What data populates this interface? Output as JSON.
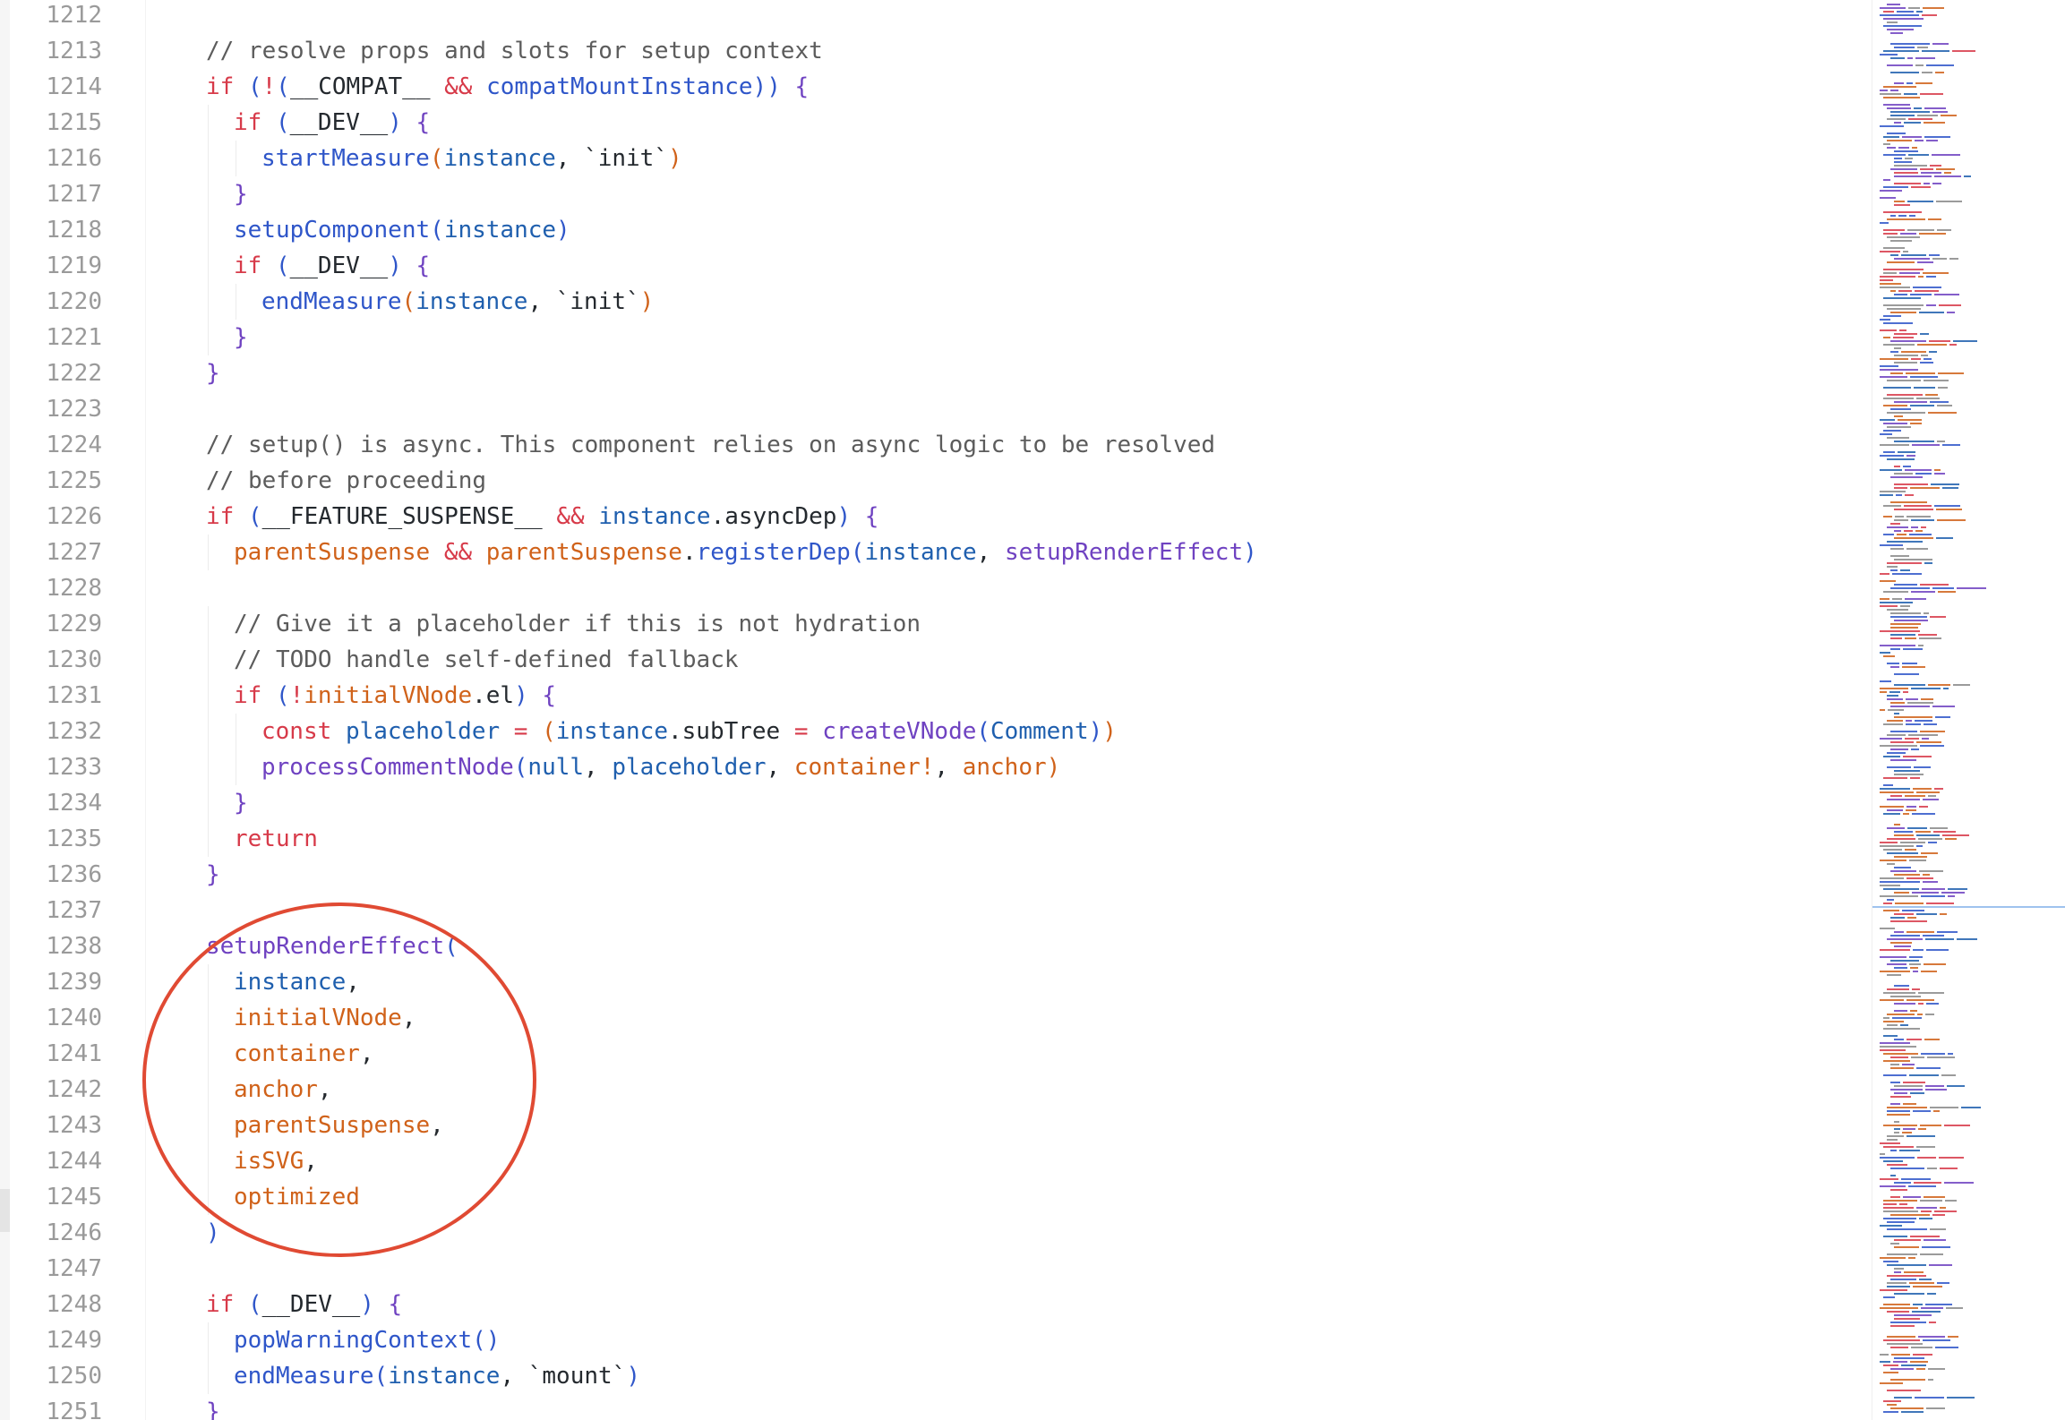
{
  "editor": {
    "language": "TypeScript",
    "first_line": 1212,
    "lines": [
      {
        "n": "1212",
        "indent": 0,
        "tokens": []
      },
      {
        "n": "1213",
        "indent": 1,
        "tokens": [
          {
            "t": "// resolve props and slots for setup context",
            "c": "cm"
          }
        ]
      },
      {
        "n": "1214",
        "indent": 1,
        "tokens": [
          {
            "t": "if",
            "c": "kw"
          },
          {
            "t": " ",
            "c": "pun"
          },
          {
            "t": "(",
            "c": "par"
          },
          {
            "t": "!",
            "c": "op"
          },
          {
            "t": "(",
            "c": "par"
          },
          {
            "t": "__COMPAT__",
            "c": "str"
          },
          {
            "t": " ",
            "c": "pun"
          },
          {
            "t": "&&",
            "c": "op"
          },
          {
            "t": " ",
            "c": "pun"
          },
          {
            "t": "compatMountInstance",
            "c": "fn"
          },
          {
            "t": ")",
            "c": "par"
          },
          {
            "t": ")",
            "c": "par"
          },
          {
            "t": " ",
            "c": "pun"
          },
          {
            "t": "{",
            "c": "fnp"
          }
        ]
      },
      {
        "n": "1215",
        "indent": 2,
        "tokens": [
          {
            "t": "if",
            "c": "kw"
          },
          {
            "t": " ",
            "c": "pun"
          },
          {
            "t": "(",
            "c": "par"
          },
          {
            "t": "__DEV__",
            "c": "str"
          },
          {
            "t": ")",
            "c": "par"
          },
          {
            "t": " ",
            "c": "pun"
          },
          {
            "t": "{",
            "c": "fnp"
          }
        ]
      },
      {
        "n": "1216",
        "indent": 3,
        "tokens": [
          {
            "t": "startMeasure",
            "c": "fn"
          },
          {
            "t": "(",
            "c": "param"
          },
          {
            "t": "instance",
            "c": "var"
          },
          {
            "t": ", ",
            "c": "pun"
          },
          {
            "t": "`init`",
            "c": "str"
          },
          {
            "t": ")",
            "c": "param"
          }
        ]
      },
      {
        "n": "1217",
        "indent": 2,
        "tokens": [
          {
            "t": "}",
            "c": "fnp"
          }
        ]
      },
      {
        "n": "1218",
        "indent": 2,
        "tokens": [
          {
            "t": "setupComponent",
            "c": "fn"
          },
          {
            "t": "(",
            "c": "par"
          },
          {
            "t": "instance",
            "c": "var"
          },
          {
            "t": ")",
            "c": "par"
          }
        ]
      },
      {
        "n": "1219",
        "indent": 2,
        "tokens": [
          {
            "t": "if",
            "c": "kw"
          },
          {
            "t": " ",
            "c": "pun"
          },
          {
            "t": "(",
            "c": "par"
          },
          {
            "t": "__DEV__",
            "c": "str"
          },
          {
            "t": ")",
            "c": "par"
          },
          {
            "t": " ",
            "c": "pun"
          },
          {
            "t": "{",
            "c": "fnp"
          }
        ]
      },
      {
        "n": "1220",
        "indent": 3,
        "tokens": [
          {
            "t": "endMeasure",
            "c": "fn"
          },
          {
            "t": "(",
            "c": "param"
          },
          {
            "t": "instance",
            "c": "var"
          },
          {
            "t": ", ",
            "c": "pun"
          },
          {
            "t": "`init`",
            "c": "str"
          },
          {
            "t": ")",
            "c": "param"
          }
        ]
      },
      {
        "n": "1221",
        "indent": 2,
        "tokens": [
          {
            "t": "}",
            "c": "fnp"
          }
        ]
      },
      {
        "n": "1222",
        "indent": 1,
        "tokens": [
          {
            "t": "}",
            "c": "fnp"
          }
        ]
      },
      {
        "n": "1223",
        "indent": 0,
        "tokens": []
      },
      {
        "n": "1224",
        "indent": 1,
        "tokens": [
          {
            "t": "// setup() is async. This component relies on async logic to be resolved",
            "c": "cm"
          }
        ]
      },
      {
        "n": "1225",
        "indent": 1,
        "tokens": [
          {
            "t": "// before proceeding",
            "c": "cm"
          }
        ]
      },
      {
        "n": "1226",
        "indent": 1,
        "tokens": [
          {
            "t": "if",
            "c": "kw"
          },
          {
            "t": " ",
            "c": "pun"
          },
          {
            "t": "(",
            "c": "par"
          },
          {
            "t": "__FEATURE_SUSPENSE__",
            "c": "str"
          },
          {
            "t": " ",
            "c": "pun"
          },
          {
            "t": "&&",
            "c": "op"
          },
          {
            "t": " ",
            "c": "pun"
          },
          {
            "t": "instance",
            "c": "var"
          },
          {
            "t": ".asyncDep",
            "c": "str"
          },
          {
            "t": ")",
            "c": "par"
          },
          {
            "t": " ",
            "c": "pun"
          },
          {
            "t": "{",
            "c": "fnp"
          }
        ]
      },
      {
        "n": "1227",
        "indent": 2,
        "tokens": [
          {
            "t": "parentSuspense",
            "c": "param"
          },
          {
            "t": " ",
            "c": "pun"
          },
          {
            "t": "&&",
            "c": "op"
          },
          {
            "t": " ",
            "c": "pun"
          },
          {
            "t": "parentSuspense",
            "c": "param"
          },
          {
            "t": ".",
            "c": "pun"
          },
          {
            "t": "registerDep",
            "c": "fn"
          },
          {
            "t": "(",
            "c": "par"
          },
          {
            "t": "instance",
            "c": "var"
          },
          {
            "t": ", ",
            "c": "pun"
          },
          {
            "t": "setupRenderEffect",
            "c": "fnp"
          },
          {
            "t": ")",
            "c": "par"
          }
        ]
      },
      {
        "n": "1228",
        "indent": 0,
        "tokens": []
      },
      {
        "n": "1229",
        "indent": 2,
        "tokens": [
          {
            "t": "// Give it a placeholder if this is not hydration",
            "c": "cm"
          }
        ]
      },
      {
        "n": "1230",
        "indent": 2,
        "tokens": [
          {
            "t": "// TODO handle self-defined fallback",
            "c": "cm"
          }
        ]
      },
      {
        "n": "1231",
        "indent": 2,
        "tokens": [
          {
            "t": "if",
            "c": "kw"
          },
          {
            "t": " ",
            "c": "pun"
          },
          {
            "t": "(",
            "c": "par"
          },
          {
            "t": "!",
            "c": "op"
          },
          {
            "t": "initialVNode",
            "c": "param"
          },
          {
            "t": ".el",
            "c": "str"
          },
          {
            "t": ")",
            "c": "par"
          },
          {
            "t": " ",
            "c": "pun"
          },
          {
            "t": "{",
            "c": "fnp"
          }
        ]
      },
      {
        "n": "1232",
        "indent": 3,
        "tokens": [
          {
            "t": "const",
            "c": "kw"
          },
          {
            "t": " ",
            "c": "pun"
          },
          {
            "t": "placeholder",
            "c": "var"
          },
          {
            "t": " ",
            "c": "pun"
          },
          {
            "t": "=",
            "c": "op"
          },
          {
            "t": " ",
            "c": "pun"
          },
          {
            "t": "(",
            "c": "param"
          },
          {
            "t": "instance",
            "c": "var"
          },
          {
            "t": ".subTree",
            "c": "str"
          },
          {
            "t": " ",
            "c": "pun"
          },
          {
            "t": "=",
            "c": "op"
          },
          {
            "t": " ",
            "c": "pun"
          },
          {
            "t": "createVNode",
            "c": "fnp"
          },
          {
            "t": "(",
            "c": "par"
          },
          {
            "t": "Comment",
            "c": "var"
          },
          {
            "t": ")",
            "c": "par"
          },
          {
            "t": ")",
            "c": "param"
          }
        ]
      },
      {
        "n": "1233",
        "indent": 3,
        "tokens": [
          {
            "t": "processCommentNode",
            "c": "fnp"
          },
          {
            "t": "(",
            "c": "par"
          },
          {
            "t": "null",
            "c": "var"
          },
          {
            "t": ", ",
            "c": "pun"
          },
          {
            "t": "placeholder",
            "c": "var"
          },
          {
            "t": ", ",
            "c": "pun"
          },
          {
            "t": "container!",
            "c": "param"
          },
          {
            "t": ", ",
            "c": "pun"
          },
          {
            "t": "anchor",
            "c": "param"
          },
          {
            "t": ")",
            "c": "param"
          }
        ]
      },
      {
        "n": "1234",
        "indent": 2,
        "tokens": [
          {
            "t": "}",
            "c": "fnp"
          }
        ]
      },
      {
        "n": "1235",
        "indent": 2,
        "tokens": [
          {
            "t": "return",
            "c": "kw"
          }
        ]
      },
      {
        "n": "1236",
        "indent": 1,
        "tokens": [
          {
            "t": "}",
            "c": "fnp"
          }
        ]
      },
      {
        "n": "1237",
        "indent": 0,
        "tokens": []
      },
      {
        "n": "1238",
        "indent": 1,
        "tokens": [
          {
            "t": "setupRenderEffect",
            "c": "fnp"
          },
          {
            "t": "(",
            "c": "par"
          }
        ]
      },
      {
        "n": "1239",
        "indent": 2,
        "tokens": [
          {
            "t": "instance",
            "c": "var"
          },
          {
            "t": ",",
            "c": "pun"
          }
        ]
      },
      {
        "n": "1240",
        "indent": 2,
        "tokens": [
          {
            "t": "initialVNode",
            "c": "param"
          },
          {
            "t": ",",
            "c": "pun"
          }
        ]
      },
      {
        "n": "1241",
        "indent": 2,
        "tokens": [
          {
            "t": "container",
            "c": "param"
          },
          {
            "t": ",",
            "c": "pun"
          }
        ]
      },
      {
        "n": "1242",
        "indent": 2,
        "tokens": [
          {
            "t": "anchor",
            "c": "param"
          },
          {
            "t": ",",
            "c": "pun"
          }
        ]
      },
      {
        "n": "1243",
        "indent": 2,
        "tokens": [
          {
            "t": "parentSuspense",
            "c": "param"
          },
          {
            "t": ",",
            "c": "pun"
          }
        ]
      },
      {
        "n": "1244",
        "indent": 2,
        "tokens": [
          {
            "t": "isSVG",
            "c": "param"
          },
          {
            "t": ",",
            "c": "pun"
          }
        ]
      },
      {
        "n": "1245",
        "indent": 2,
        "tokens": [
          {
            "t": "optimized",
            "c": "param"
          }
        ]
      },
      {
        "n": "1246",
        "indent": 1,
        "tokens": [
          {
            "t": ")",
            "c": "par"
          }
        ]
      },
      {
        "n": "1247",
        "indent": 0,
        "tokens": []
      },
      {
        "n": "1248",
        "indent": 1,
        "tokens": [
          {
            "t": "if",
            "c": "kw"
          },
          {
            "t": " ",
            "c": "pun"
          },
          {
            "t": "(",
            "c": "par"
          },
          {
            "t": "__DEV__",
            "c": "str"
          },
          {
            "t": ")",
            "c": "par"
          },
          {
            "t": " ",
            "c": "pun"
          },
          {
            "t": "{",
            "c": "fnp"
          }
        ]
      },
      {
        "n": "1249",
        "indent": 2,
        "tokens": [
          {
            "t": "popWarningContext",
            "c": "fn"
          },
          {
            "t": "()",
            "c": "par"
          }
        ]
      },
      {
        "n": "1250",
        "indent": 2,
        "tokens": [
          {
            "t": "endMeasure",
            "c": "fn"
          },
          {
            "t": "(",
            "c": "par"
          },
          {
            "t": "instance",
            "c": "var"
          },
          {
            "t": ", ",
            "c": "pun"
          },
          {
            "t": "`mount`",
            "c": "str"
          },
          {
            "t": ")",
            "c": "par"
          }
        ]
      },
      {
        "n": "1251",
        "indent": 1,
        "tokens": [
          {
            "t": "}",
            "c": "fnp"
          }
        ]
      }
    ]
  },
  "annotation": {
    "shape": "ellipse",
    "color": "#e04a33",
    "target": "setupRenderEffect call"
  },
  "colors": {
    "keyword": "#d73a49",
    "function": "#2f56c9",
    "function_alt": "#6f42c1",
    "variable": "#1f5fae",
    "parameter": "#d0621a",
    "comment": "#5c5c5c",
    "text": "#24292e",
    "line_number": "#9a9a9a"
  },
  "minimap": {
    "visible": true
  }
}
